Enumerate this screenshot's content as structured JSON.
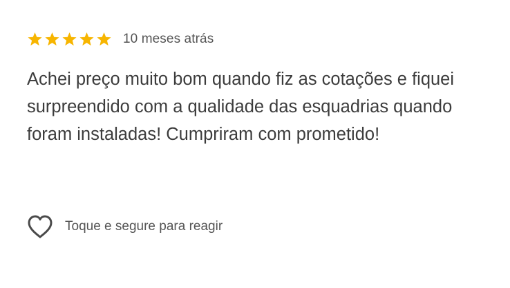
{
  "review": {
    "rating": 5,
    "rating_max": 5,
    "star_color": "#F7B500",
    "star_icon": "star-icon",
    "time_ago": "10 meses atrás",
    "text": "Achei preço muito bom quando fiz as cotações e fiquei surpreendido com a qualidade das esquadrias quando foram instaladas! Cumpriram com prometido!"
  },
  "reaction": {
    "icon": "heart-outline-icon",
    "label": "Toque e segure para reagir"
  }
}
